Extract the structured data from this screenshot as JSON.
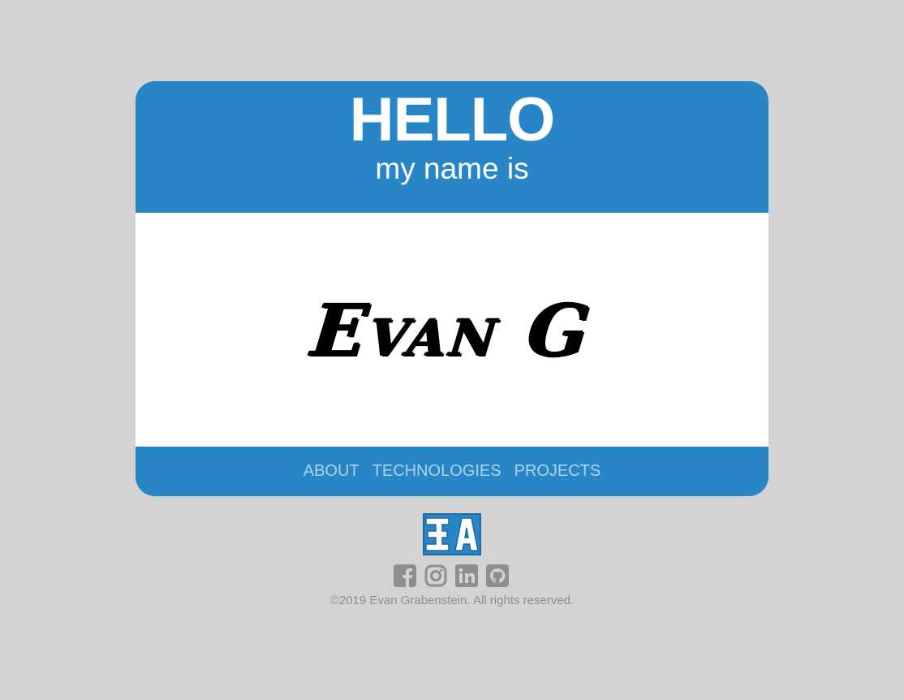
{
  "badge": {
    "greeting": "HELLO",
    "subtitle": "my name is",
    "name": "Evan G"
  },
  "nav": {
    "items": [
      {
        "label": "ABOUT"
      },
      {
        "label": "TECHNOLOGIES"
      },
      {
        "label": "PROJECTS"
      }
    ]
  },
  "logo": {
    "mark": "EG"
  },
  "social": {
    "icons": [
      "facebook-icon",
      "instagram-icon",
      "linkedin-icon",
      "github-icon"
    ]
  },
  "footer": {
    "copyright": "©2019 Evan Grabenstein. All rights reserved."
  },
  "colors": {
    "brand_blue": "#2886c6",
    "background": "#d3d3d3",
    "nav_text": "#a9d4f0",
    "icon_gray": "#8e8e8e"
  }
}
